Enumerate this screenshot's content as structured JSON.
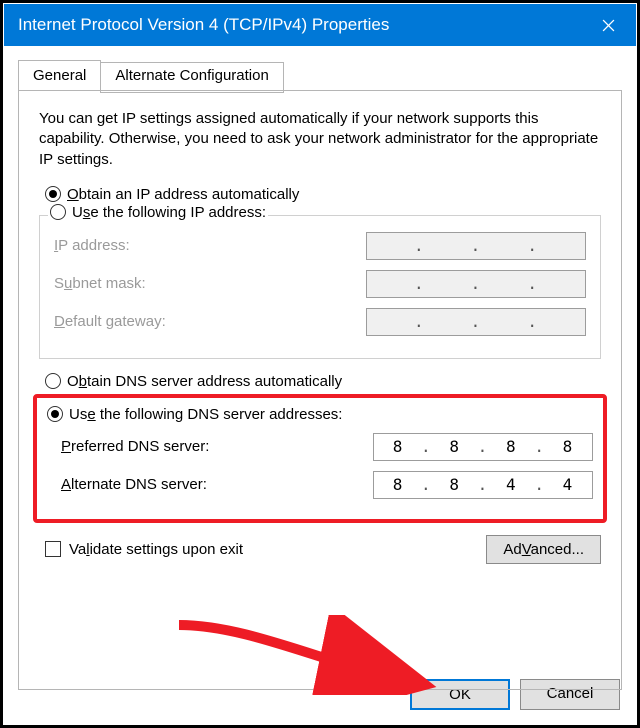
{
  "window": {
    "title": "Internet Protocol Version 4 (TCP/IPv4) Properties"
  },
  "tabs": {
    "general": "General",
    "alternate": "Alternate Configuration"
  },
  "intro": "You can get IP settings assigned automatically if your network supports this capability. Otherwise, you need to ask your network administrator for the appropriate IP settings.",
  "ip_section": {
    "obtain_auto": "Obtain an IP address automatically",
    "obtain_auto_accel": "O",
    "use_following": "Use the following IP address:",
    "use_following_accel": "s",
    "ip_label": "IP address:",
    "ip_accel": "I",
    "subnet_label": "Subnet mask:",
    "subnet_accel": "u",
    "gateway_label": "Default gateway:",
    "gateway_accel": "D",
    "selected": "auto"
  },
  "dns_section": {
    "obtain_auto": "Obtain DNS server address automatically",
    "obtain_auto_accel": "b",
    "use_following": "Use the following DNS server addresses:",
    "use_following_accel": "e",
    "preferred_label": "Preferred DNS server:",
    "preferred_accel": "P",
    "alternate_label": "Alternate DNS server:",
    "alternate_accel": "A",
    "preferred_value": [
      "8",
      "8",
      "8",
      "8"
    ],
    "alternate_value": [
      "8",
      "8",
      "4",
      "4"
    ],
    "selected": "manual"
  },
  "validate": {
    "label": "Validate settings upon exit",
    "accel": "l",
    "checked": false
  },
  "buttons": {
    "advanced": "Advanced...",
    "advanced_accel": "V",
    "ok": "OK",
    "cancel": "Cancel"
  },
  "highlight_color": "#ee1c25"
}
